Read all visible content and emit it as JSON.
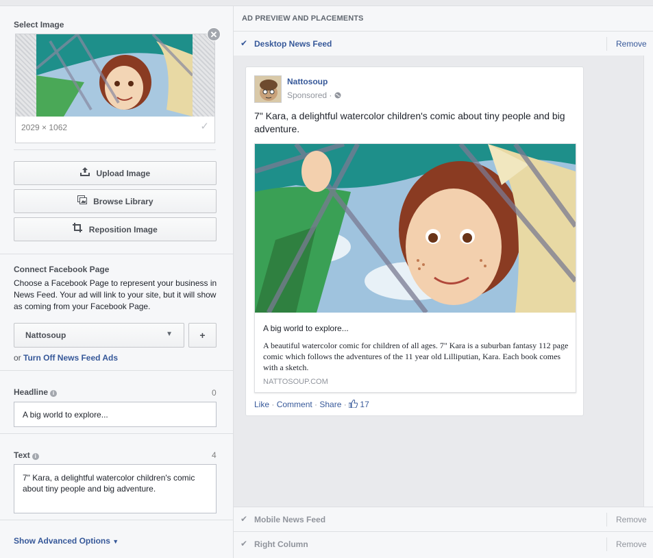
{
  "left": {
    "select_image": {
      "title": "Select Image",
      "dimensions": "2029 × 1062",
      "close_glyph": "✕",
      "check_glyph": "✓"
    },
    "buttons": {
      "upload": "Upload Image",
      "browse": "Browse Library",
      "reposition": "Reposition Image"
    },
    "connect_page": {
      "title": "Connect Facebook Page",
      "description": "Choose a Facebook Page to represent your business in News Feed. Your ad will link to your site, but it will show as coming from your Facebook Page.",
      "selected_page": "Nattosoup",
      "add_label": "+",
      "turn_off_prefix": "or",
      "turn_off_link": "Turn Off News Feed Ads"
    },
    "headline": {
      "label": "Headline",
      "count": "0",
      "value": "A big world to explore..."
    },
    "text": {
      "label": "Text",
      "count": "4",
      "value": "7\" Kara, a delightful watercolor children's comic about tiny people and big adventure."
    },
    "advanced_label": "Show Advanced Options"
  },
  "right": {
    "header": "AD PREVIEW AND PLACEMENTS",
    "placements": [
      {
        "label": "Desktop News Feed",
        "remove": "Remove",
        "active": true
      },
      {
        "label": "Mobile News Feed",
        "remove": "Remove",
        "active": false
      },
      {
        "label": "Right Column",
        "remove": "Remove",
        "active": false
      }
    ],
    "post": {
      "page_name": "Nattosoup",
      "sponsored": "Sponsored",
      "text": "7\" Kara, a delightful watercolor children's comic about tiny people and big adventure.",
      "link_title": "A big world to explore...",
      "link_description": "A beautiful watercolor comic for children of all ages. 7\" Kara is a suburban fantasy 112 page comic which follows the adventures of the 11 year old Lilliputian, Kara. Each book comes with a sketch.",
      "link_domain": "NATTOSOUP.COM",
      "actions": {
        "like": "Like",
        "comment": "Comment",
        "share": "Share",
        "like_count": "17"
      }
    }
  },
  "colors": {
    "link_blue": "#365899",
    "muted_gray": "#90949c",
    "panel_bg": "#f6f7f9",
    "preview_bg": "#e9eaed"
  },
  "icons": [
    "close-icon",
    "check-icon",
    "upload-icon",
    "library-icon",
    "crop-icon",
    "caret-down-icon",
    "info-icon",
    "globe-icon",
    "thumbs-up-icon"
  ]
}
